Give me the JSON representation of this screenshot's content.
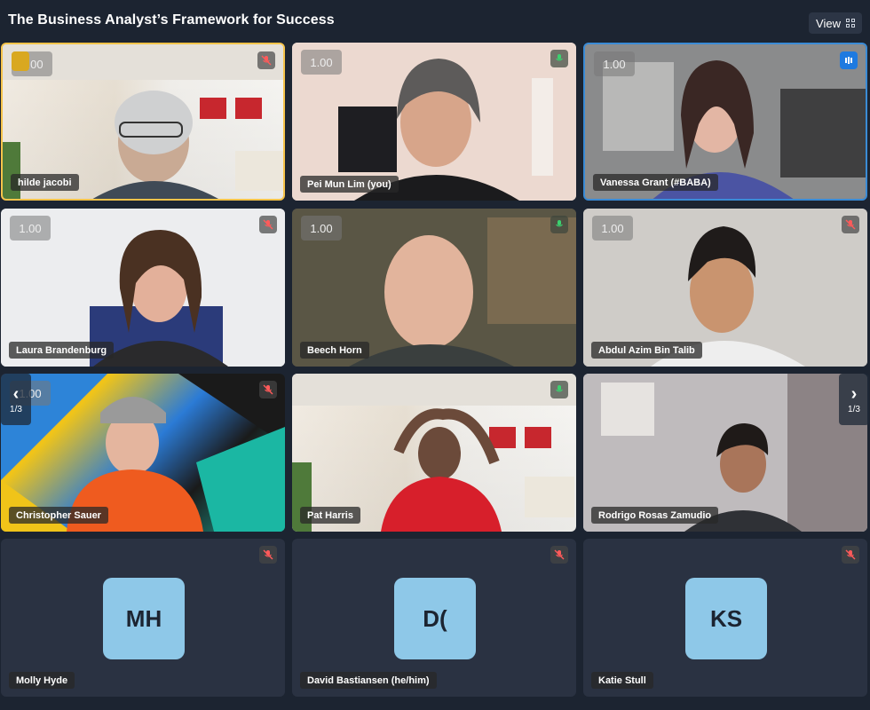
{
  "meeting": {
    "title": "The Business Analyst’s Framework for Success",
    "view_label": "View"
  },
  "pagers": {
    "left": {
      "arrow": "‹",
      "label": "1/3"
    },
    "right": {
      "arrow": "›",
      "label": "1/3"
    }
  },
  "tiles": [
    {
      "name": "hilde jacobi",
      "zoom": "1.00",
      "mic": "muted",
      "hand_raised": true
    },
    {
      "name": "Pei Mun Lim (you)",
      "zoom": "1.00",
      "mic": "on"
    },
    {
      "name": "Vanessa Grant (#BABA)",
      "zoom": "1.00",
      "mic": "speaking"
    },
    {
      "name": "Laura Brandenburg",
      "zoom": "1.00",
      "mic": "muted"
    },
    {
      "name": "Beech Horn",
      "zoom": "1.00",
      "mic": "on"
    },
    {
      "name": "Abdul Azim Bin Talib",
      "zoom": "1.00",
      "mic": "muted"
    },
    {
      "name": "Christopher Sauer",
      "zoom": "1.00",
      "mic": "muted"
    },
    {
      "name": "Pat Harris",
      "zoom": null,
      "mic": "on"
    },
    {
      "name": "Rodrigo Rosas Zamudio",
      "zoom": null,
      "mic": null
    },
    {
      "name": "Molly Hyde",
      "initials": "MH",
      "mic": "muted"
    },
    {
      "name": "David Bastiansen (he/him)",
      "initials": "D(",
      "mic": "muted"
    },
    {
      "name": "Katie Stull",
      "initials": "KS",
      "mic": "muted"
    }
  ],
  "colors": {
    "background": "#1c2431",
    "avatar": "#8ec8e8",
    "speaking_border": "#f5c34a",
    "active_border": "#3a8bd6",
    "muted_icon": "#ff5a5a",
    "mic_on_icon": "#3bd16f"
  }
}
